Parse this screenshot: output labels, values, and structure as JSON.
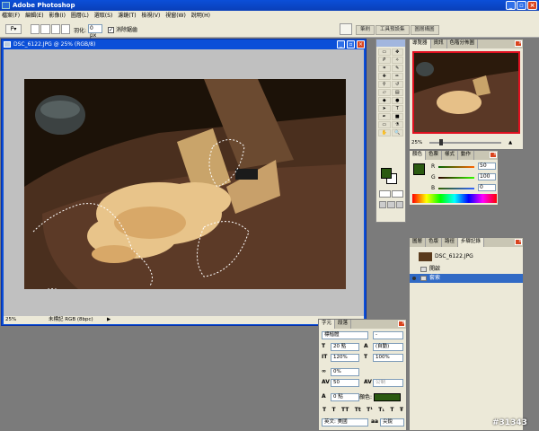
{
  "app": {
    "title": "Adobe Photoshop"
  },
  "menu": [
    "檔案(F)",
    "編輯(E)",
    "影像(I)",
    "圖層(L)",
    "選取(S)",
    "濾鏡(T)",
    "檢視(V)",
    "視窗(W)",
    "說明(H)"
  ],
  "options": {
    "feather_label": "羽化:",
    "feather_value": "0 px",
    "antialias_label": "消除鋸齒"
  },
  "well_tabs": [
    "筆刷",
    "工具預設集",
    "圖層構圖"
  ],
  "document": {
    "title": "DSC_6122.JPG @ 25% (RGB/8)",
    "zoom": "25%",
    "status": "未標記 RGB (8bpc)"
  },
  "navigator": {
    "tabs": [
      "導覽器",
      "資訊",
      "色階分佈圖"
    ],
    "zoom": "25%"
  },
  "color": {
    "tabs": [
      "顏色",
      "色票",
      "樣式",
      "動作"
    ],
    "channels": [
      {
        "label": "R",
        "value": "50"
      },
      {
        "label": "G",
        "value": "100"
      },
      {
        "label": "B",
        "value": "0"
      }
    ],
    "fg_color": "#2b5a11"
  },
  "history": {
    "tabs": [
      "圖層",
      "色版",
      "路徑",
      "步驟記錄"
    ],
    "snapshot": "DSC_6122.JPG",
    "steps": [
      "開啟",
      "套索"
    ]
  },
  "character": {
    "tabs": [
      "字元",
      "段落"
    ],
    "font": "標楷體",
    "size": "20 點",
    "leading": "(自動)",
    "vscale": "120%",
    "hscale": "100%",
    "tracking_pct": "0%",
    "kerning": "50",
    "kerning_mode": "公制",
    "baseline": "0 點",
    "color_label": "顏色:",
    "lang": "英文: 美國",
    "aa_mode": "尖銳"
  },
  "watermark": "#31343"
}
